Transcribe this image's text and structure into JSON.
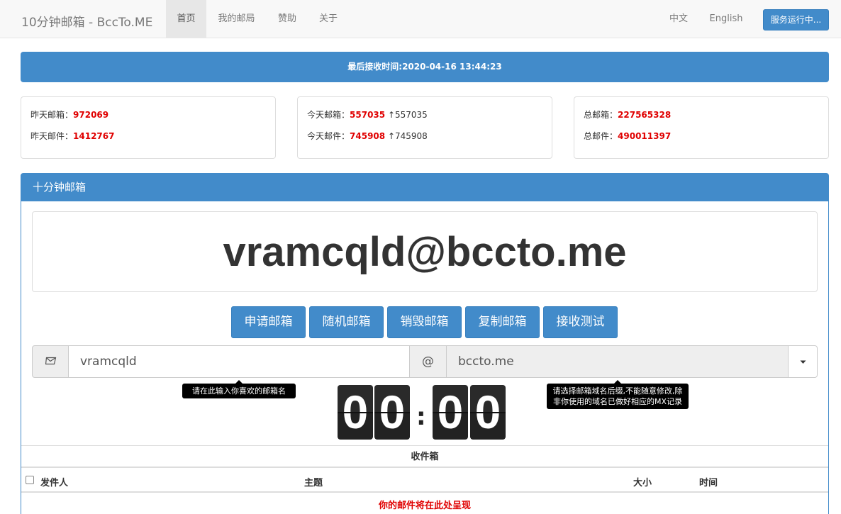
{
  "navbar": {
    "brand": "10分钟邮箱 - BccTo.ME",
    "items": [
      {
        "label": "首页"
      },
      {
        "label": "我的邮局"
      },
      {
        "label": "赞助"
      },
      {
        "label": "关于"
      }
    ],
    "lang_zh": "中文",
    "lang_en": "English",
    "status_button": "服务运行中..."
  },
  "banner": {
    "text": "最后接收时间:2020-04-16 13:44:23"
  },
  "stats": {
    "yesterday_boxes_label": "昨天邮箱：",
    "yesterday_boxes": "972069",
    "yesterday_mails_label": "昨天邮件：",
    "yesterday_mails": "1412767",
    "today_boxes_label": "今天邮箱：",
    "today_boxes": "557035",
    "today_boxes_delta": "↑557035",
    "today_mails_label": "今天邮件：",
    "today_mails": "745908",
    "today_mails_delta": "↑745908",
    "total_boxes_label": "总邮箱：",
    "total_boxes": "227565328",
    "total_mails_label": "总邮件：",
    "total_mails": "490011397"
  },
  "panel": {
    "title": "十分钟邮箱",
    "email_address": "vramcqld@bccto.me",
    "buttons": {
      "apply": "申请邮箱",
      "random": "随机邮箱",
      "destroy": "销毁邮箱",
      "copy": "复制邮箱",
      "test": "接收测试"
    },
    "username_value": "vramcqld",
    "at_sign": "@",
    "domain_value": "bccto.me",
    "tooltip_username": "请在此输入你喜欢的邮箱名",
    "tooltip_domain": "请选择邮箱域名后缀,不能随意修改,除非你使用的域名已做好相应的MX记录",
    "countdown": {
      "d1": "0",
      "d2": "0",
      "separator": ":",
      "d3": "0",
      "d4": "0"
    }
  },
  "inbox": {
    "title": "收件箱",
    "columns": {
      "sender": "发件人",
      "subject": "主题",
      "size": "大小",
      "time": "时间"
    },
    "empty_message": "你的邮件将在此处呈现"
  },
  "colors": {
    "primary": "#428bca",
    "highlight_red": "#e00000",
    "countdown_bg": "#222222"
  },
  "icons": {
    "username_addon": "envelope-icon",
    "domain_dropdown": "caret-down-icon"
  }
}
